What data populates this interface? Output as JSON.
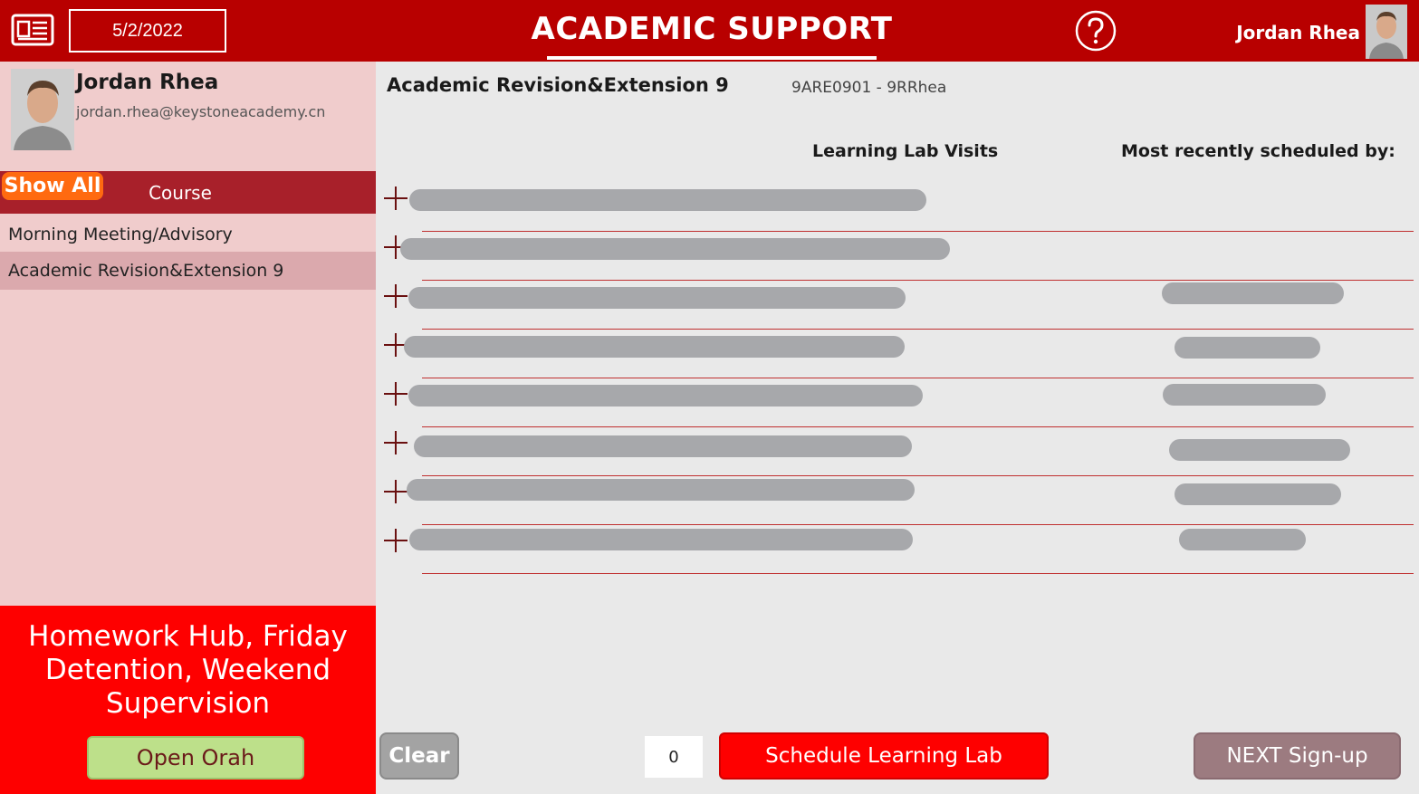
{
  "header": {
    "news_icon": "newspaper-icon",
    "date": "5/2/2022",
    "title": "ACADEMIC SUPPORT",
    "help_icon": "question-circle-icon",
    "user_name": "Jordan Rhea"
  },
  "profile": {
    "name": "Jordan Rhea",
    "email": "jordan.rhea@keystoneacademy.cn"
  },
  "courses": {
    "show_all_label": "Show All",
    "header_label": "Course",
    "items": [
      {
        "label": "Morning Meeting/Advisory",
        "selected": false
      },
      {
        "label": "Academic Revision&Extension 9",
        "selected": true
      }
    ]
  },
  "promo": {
    "text": "Homework Hub, Friday Detention, Weekend Supervision",
    "button_label": "Open Orah"
  },
  "main": {
    "course_title": "Academic Revision&Extension 9",
    "course_code": "9ARE0901 - 9RRhea",
    "columns": {
      "visits": "Learning Lab Visits",
      "scheduled_by": "Most recently scheduled by:"
    },
    "student_rows_count_redacted": 8
  },
  "footer": {
    "clear_label": "Clear",
    "count": "0",
    "schedule_label": "Schedule Learning Lab",
    "next_label": "NEXT Sign-up"
  },
  "colors": {
    "header_bg": "#b80000",
    "left_panel_bg": "#f0cccc",
    "course_header_bg": "#a8202a",
    "show_all_bg": "#ff6a10",
    "promo_bg": "#fe0000",
    "open_orah_bg": "#bde08a",
    "schedule_bg": "#fe0000",
    "next_bg": "#9c7b80",
    "clear_bg": "#a3a3a3"
  }
}
